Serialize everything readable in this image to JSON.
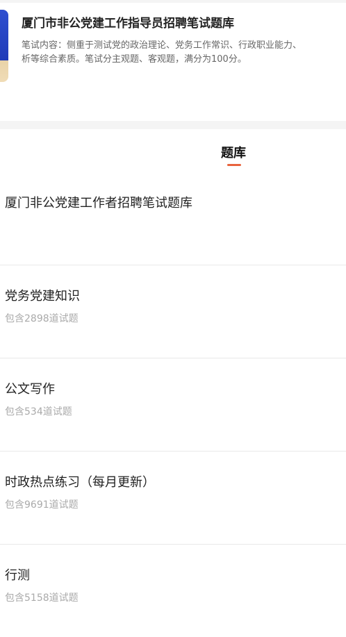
{
  "header": {
    "title": "厦门市非公党建工作指导员招聘笔试题库",
    "description_line1": "笔试内容：侧重于测试党的政治理论、党务工作常识、行政职业能力、",
    "description_line2": "析等综合素质。笔试分主观题、客观题，满分为100分。"
  },
  "tabs": [
    {
      "label": "题库",
      "active": true
    }
  ],
  "accent_color": "#e8633d",
  "items": [
    {
      "name": "厦门非公党建工作者招聘笔试题库",
      "count": ""
    },
    {
      "name": "党务党建知识",
      "count": "包含2898道试题"
    },
    {
      "name": "公文写作",
      "count": "包含534道试题"
    },
    {
      "name": "时政热点练习（每月更新）",
      "count": "包含9691道试题"
    },
    {
      "name": "行测",
      "count": "包含5158道试题"
    }
  ]
}
